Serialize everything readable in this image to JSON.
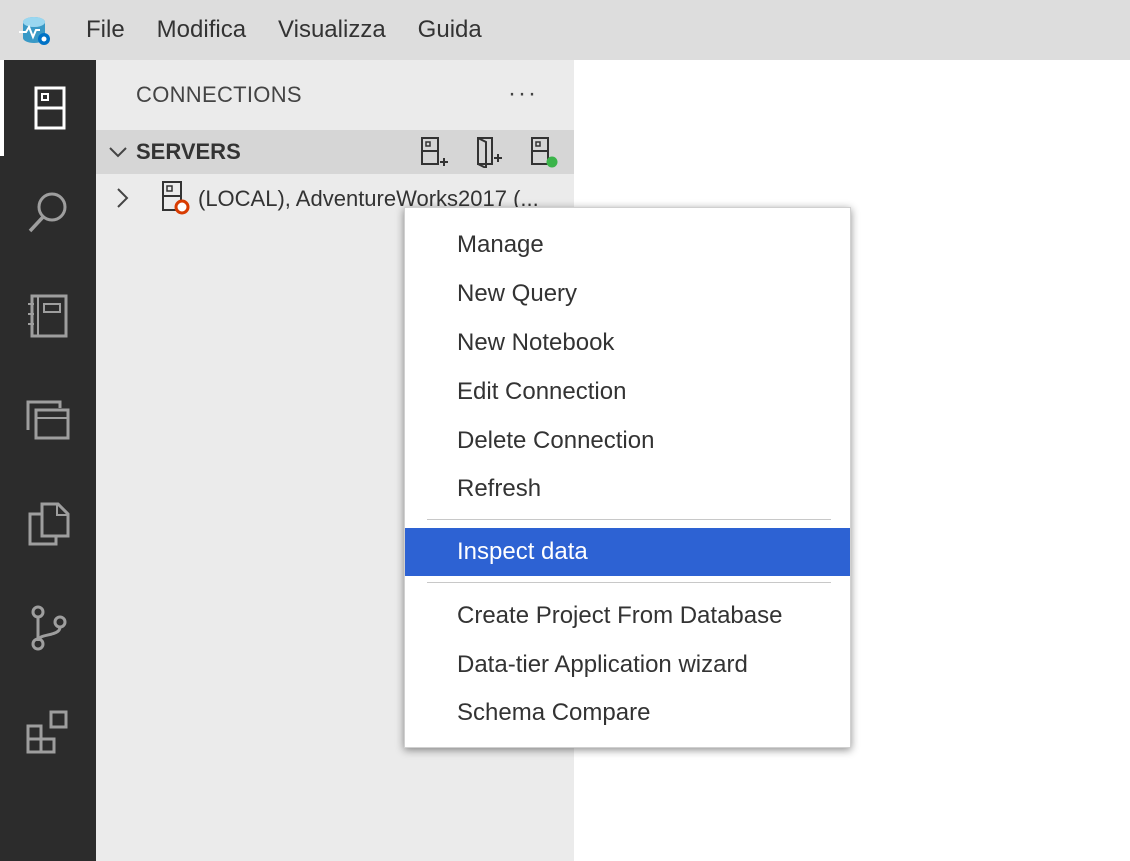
{
  "menubar": {
    "logo_icon": "azure-data-studio-logo",
    "items": [
      "File",
      "Modifica",
      "Visualizza",
      "Guida"
    ]
  },
  "activitybar": {
    "items": [
      {
        "icon": "connections-icon",
        "active": true
      },
      {
        "icon": "search-icon",
        "active": false
      },
      {
        "icon": "notebook-icon",
        "active": false
      },
      {
        "icon": "tabs-icon",
        "active": false
      },
      {
        "icon": "explorer-icon",
        "active": false
      },
      {
        "icon": "source-control-icon",
        "active": false
      },
      {
        "icon": "extensions-icon",
        "active": false
      }
    ]
  },
  "sidebar": {
    "title": "CONNECTIONS",
    "more": "···",
    "servers": {
      "label": "SERVERS",
      "actions": [
        "new-connection-icon",
        "new-server-group-icon",
        "active-connections-icon"
      ]
    },
    "tree": [
      {
        "label": "(LOCAL), AdventureWorks2017 (...",
        "status_color": "#d83b01"
      }
    ]
  },
  "context_menu": {
    "groups": [
      [
        "Manage",
        "New Query",
        "New Notebook",
        "Edit Connection",
        "Delete Connection",
        "Refresh"
      ],
      [
        "Inspect data"
      ],
      [
        "Create Project From Database",
        "Data-tier Application wizard",
        "Schema Compare"
      ]
    ],
    "selected": "Inspect data",
    "selection_color": "#2d62d3"
  }
}
